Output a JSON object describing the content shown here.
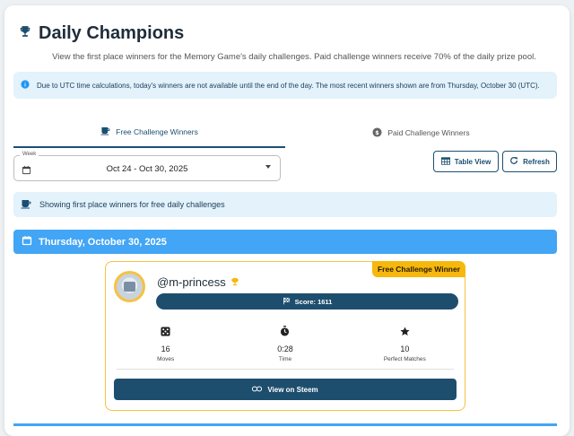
{
  "header": {
    "title": "Daily Champions",
    "subtitle": "View the first place winners for the Memory Game's daily challenges. Paid challenge winners receive 70% of the daily prize pool."
  },
  "info_banner": {
    "text": "Due to UTC time calculations, today's winners are not available until the end of the day. The most recent winners shown are from Thursday, October 30 (UTC)."
  },
  "tabs": [
    {
      "label": "Free Challenge Winners",
      "active": true
    },
    {
      "label": "Paid Challenge Winners",
      "active": false
    }
  ],
  "week_select": {
    "label": "Week",
    "value": "Oct 24 - Oct 30, 2025"
  },
  "buttons": {
    "table_view": "Table View",
    "refresh": "Refresh"
  },
  "showing_banner": {
    "text": "Showing first place winners for free daily challenges"
  },
  "date_header": "Thursday, October 30, 2025",
  "winner": {
    "badge": "Free Challenge Winner",
    "username": "@m-princess",
    "score": "Score: 1611",
    "stats": [
      {
        "value": "16",
        "label": "Moves",
        "icon": "dice-icon"
      },
      {
        "value": "0:28",
        "label": "Time",
        "icon": "stopwatch-icon"
      },
      {
        "value": "10",
        "label": "Perfect Matches",
        "icon": "star-icon"
      }
    ],
    "view_button": "View on Steem"
  },
  "colors": {
    "primary": "#1e4e6e",
    "accent_blue": "#42a5f5",
    "gold": "#f6b80c",
    "info_bg": "#e3f2fb"
  }
}
